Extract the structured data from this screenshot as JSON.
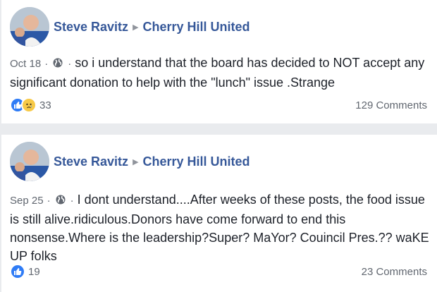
{
  "posts": [
    {
      "author": "Steve Ravitz",
      "group": "Cherry Hill United",
      "date": "Oct 18",
      "separator": "·",
      "text": "so i understand that the board has decided to NOT accept any significant donation to help with the \"lunch\" issue .Strange",
      "reaction_count": "33",
      "comments": "129 Comments"
    },
    {
      "author": "Steve Ravitz",
      "group": "Cherry Hill United",
      "date": "Sep 25",
      "separator": "·",
      "text": "I dont understand....After weeks of these posts, the food issue is still alive.ridiculous.Donors have come forward to end this nonsense.Where is the leadership?Super? MaYor? Couincil Pres.?? waKE UP folks",
      "reaction_count": "19",
      "comments": "23 Comments"
    }
  ],
  "icons": {
    "globe": "globe-icon",
    "arrow": "triangle-right-icon",
    "like": "like-reaction-icon",
    "sad": "sad-reaction-icon"
  },
  "colors": {
    "link": "#365899",
    "like": "#2f7cf6",
    "sad": "#f7c947",
    "meta": "#616770",
    "background": "#e9ebee"
  }
}
